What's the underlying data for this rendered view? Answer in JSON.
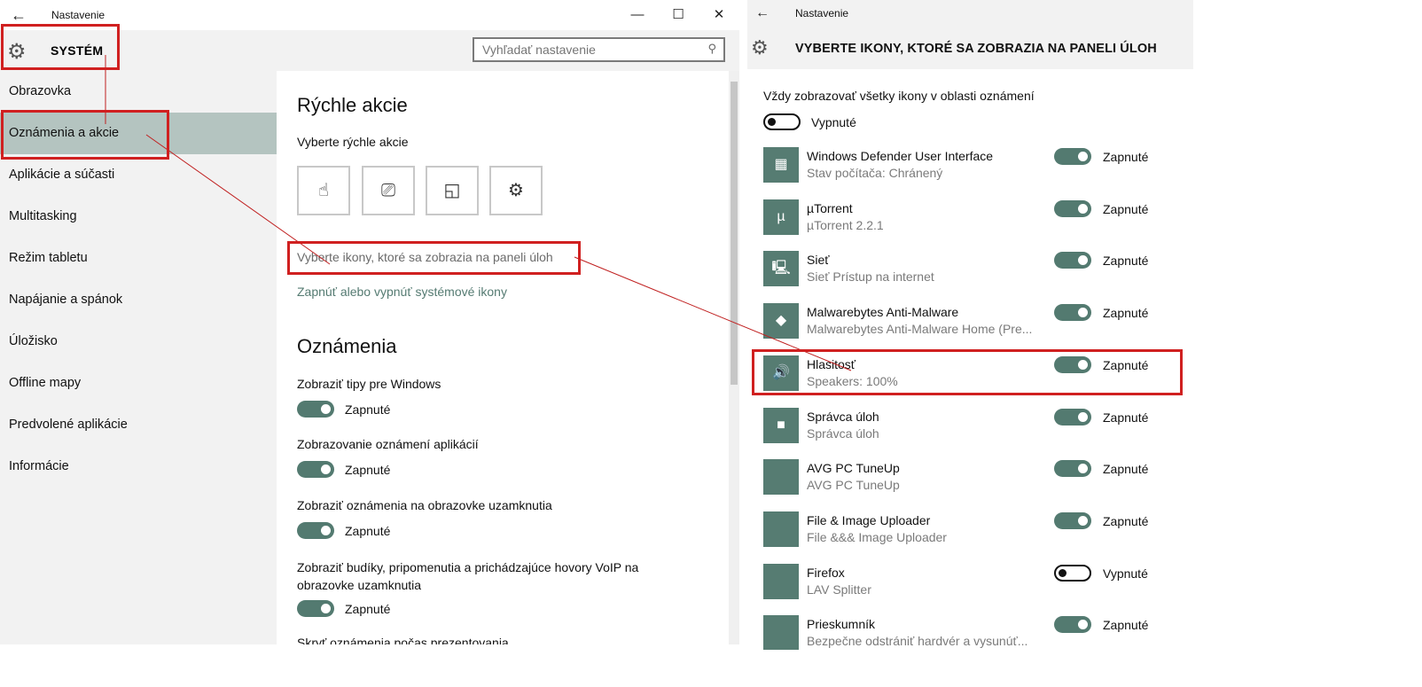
{
  "left_window": {
    "title": "Nastavenie",
    "back_glyph": "←",
    "min_glyph": "—",
    "max_glyph": "☐",
    "close_glyph": "✕",
    "header_title": "SYSTÉM",
    "search_placeholder": "Vyhľadať nastavenie",
    "sidebar": [
      {
        "label": "Obrazovka",
        "selected": false
      },
      {
        "label": "Oznámenia a akcie",
        "selected": true
      },
      {
        "label": "Aplikácie a súčasti",
        "selected": false
      },
      {
        "label": "Multitasking",
        "selected": false
      },
      {
        "label": "Režim tabletu",
        "selected": false
      },
      {
        "label": "Napájanie a spánok",
        "selected": false
      },
      {
        "label": "Úložisko",
        "selected": false
      },
      {
        "label": "Offline mapy",
        "selected": false
      },
      {
        "label": "Predvolené aplikácie",
        "selected": false
      },
      {
        "label": "Informácie",
        "selected": false
      }
    ],
    "content": {
      "quick_actions_title": "Rýchle akcie",
      "quick_actions_subtitle": "Vyberte rýchle akcie",
      "quick_action_icons": [
        "tablet-mode-icon",
        "project-icon",
        "note-icon",
        "settings-icon"
      ],
      "taskbar_icons_link": "Vyberte ikony, ktoré sa zobrazia na paneli úloh",
      "system_icons_link": "Zapnúť alebo vypnúť systémové ikony",
      "notifications_title": "Oznámenia",
      "settings": [
        {
          "label": "Zobraziť tipy pre Windows",
          "state": "Zapnuté",
          "on": true
        },
        {
          "label": "Zobrazovanie oznámení aplikácií",
          "state": "Zapnuté",
          "on": true
        },
        {
          "label": "Zobraziť oznámenia na obrazovke uzamknutia",
          "state": "Zapnuté",
          "on": true
        },
        {
          "label": "Zobraziť budíky, pripomenutia a prichádzajúce hovory VoIP na obrazovke uzamknutia",
          "state": "Zapnuté",
          "on": true
        }
      ],
      "partial_label": "Skryť oznámenia počas prezentovania"
    }
  },
  "right_window": {
    "title": "Nastavenie",
    "back_glyph": "←",
    "header_title": "VYBERTE IKONY, KTORÉ SA ZOBRAZIA NA PANELI ÚLOH",
    "always_show_label": "Vždy zobrazovať všetky ikony v oblasti oznámení",
    "always_show_state": "Vypnuté",
    "always_show_on": false,
    "apps": [
      {
        "name": "Windows Defender User Interface",
        "sub": "Stav počítača: Chránený",
        "state": "Zapnuté",
        "on": true,
        "icon": "defender-icon",
        "glyph": "▦"
      },
      {
        "name": "µTorrent",
        "sub": "µTorrent 2.2.1",
        "state": "Zapnuté",
        "on": true,
        "icon": "utorrent-icon",
        "glyph": "µ"
      },
      {
        "name": "Sieť",
        "sub": "Sieť Prístup na internet",
        "state": "Zapnuté",
        "on": true,
        "icon": "network-icon",
        "glyph": "🖳"
      },
      {
        "name": "Malwarebytes Anti-Malware",
        "sub": "Malwarebytes Anti-Malware Home (Pre...",
        "state": "Zapnuté",
        "on": true,
        "icon": "malwarebytes-icon",
        "glyph": "◆"
      },
      {
        "name": "Hlasitosť",
        "sub": "Speakers: 100%",
        "state": "Zapnuté",
        "on": true,
        "icon": "speaker-icon",
        "glyph": "🔊"
      },
      {
        "name": "Správca úloh",
        "sub": "Správca úloh",
        "state": "Zapnuté",
        "on": true,
        "icon": "task-manager-icon",
        "glyph": "■"
      },
      {
        "name": "AVG PC TuneUp",
        "sub": "AVG PC TuneUp",
        "state": "Zapnuté",
        "on": true,
        "icon": "app-icon",
        "glyph": ""
      },
      {
        "name": "File & Image Uploader",
        "sub": "File &&& Image Uploader",
        "state": "Zapnuté",
        "on": true,
        "icon": "app-icon",
        "glyph": ""
      },
      {
        "name": "Firefox",
        "sub": "LAV Splitter",
        "state": "Vypnuté",
        "on": false,
        "icon": "app-icon",
        "glyph": ""
      },
      {
        "name": "Prieskumník",
        "sub": "Bezpečne odstrániť hardvér a vysunúť...",
        "state": "Zapnuté",
        "on": true,
        "icon": "app-icon",
        "glyph": ""
      }
    ]
  }
}
